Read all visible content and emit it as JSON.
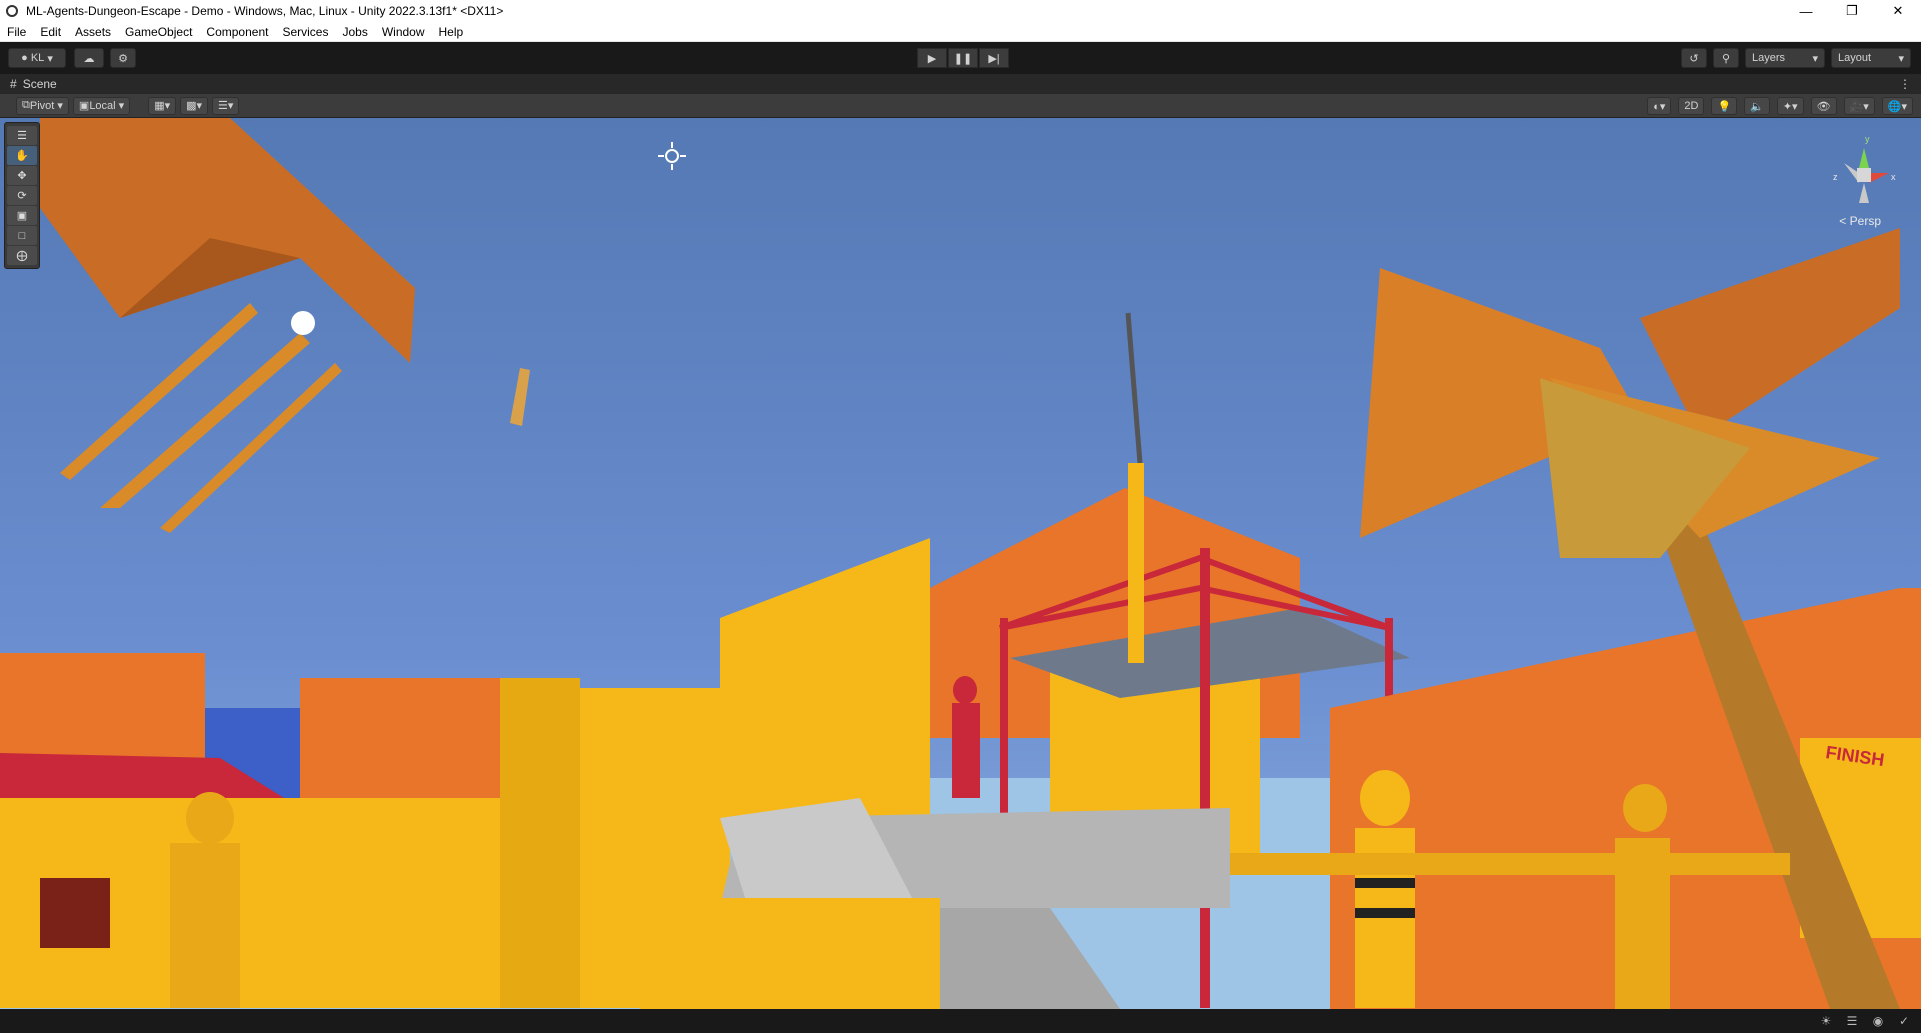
{
  "window": {
    "title": "ML-Agents-Dungeon-Escape - Demo - Windows, Mac, Linux - Unity 2022.3.13f1* <DX11>"
  },
  "menu": [
    "File",
    "Edit",
    "Assets",
    "GameObject",
    "Component",
    "Services",
    "Jobs",
    "Window",
    "Help"
  ],
  "toolbar": {
    "account": "KL",
    "layers": "Layers",
    "layout": "Layout"
  },
  "scene_tab": {
    "label": "Scene"
  },
  "scene_toolbar": {
    "pivot": "Pivot",
    "local": "Local",
    "mode_2d": "2D"
  },
  "gizmo": {
    "projection": "< Persp",
    "x": "x",
    "y": "y",
    "z": "z"
  },
  "world_text": {
    "finish": "FINISH"
  },
  "colors": {
    "sky": "#5f84c4",
    "orange": "#e8752a",
    "yellow": "#f5b818",
    "red": "#c8283a",
    "blue": "#3c5fc8"
  }
}
